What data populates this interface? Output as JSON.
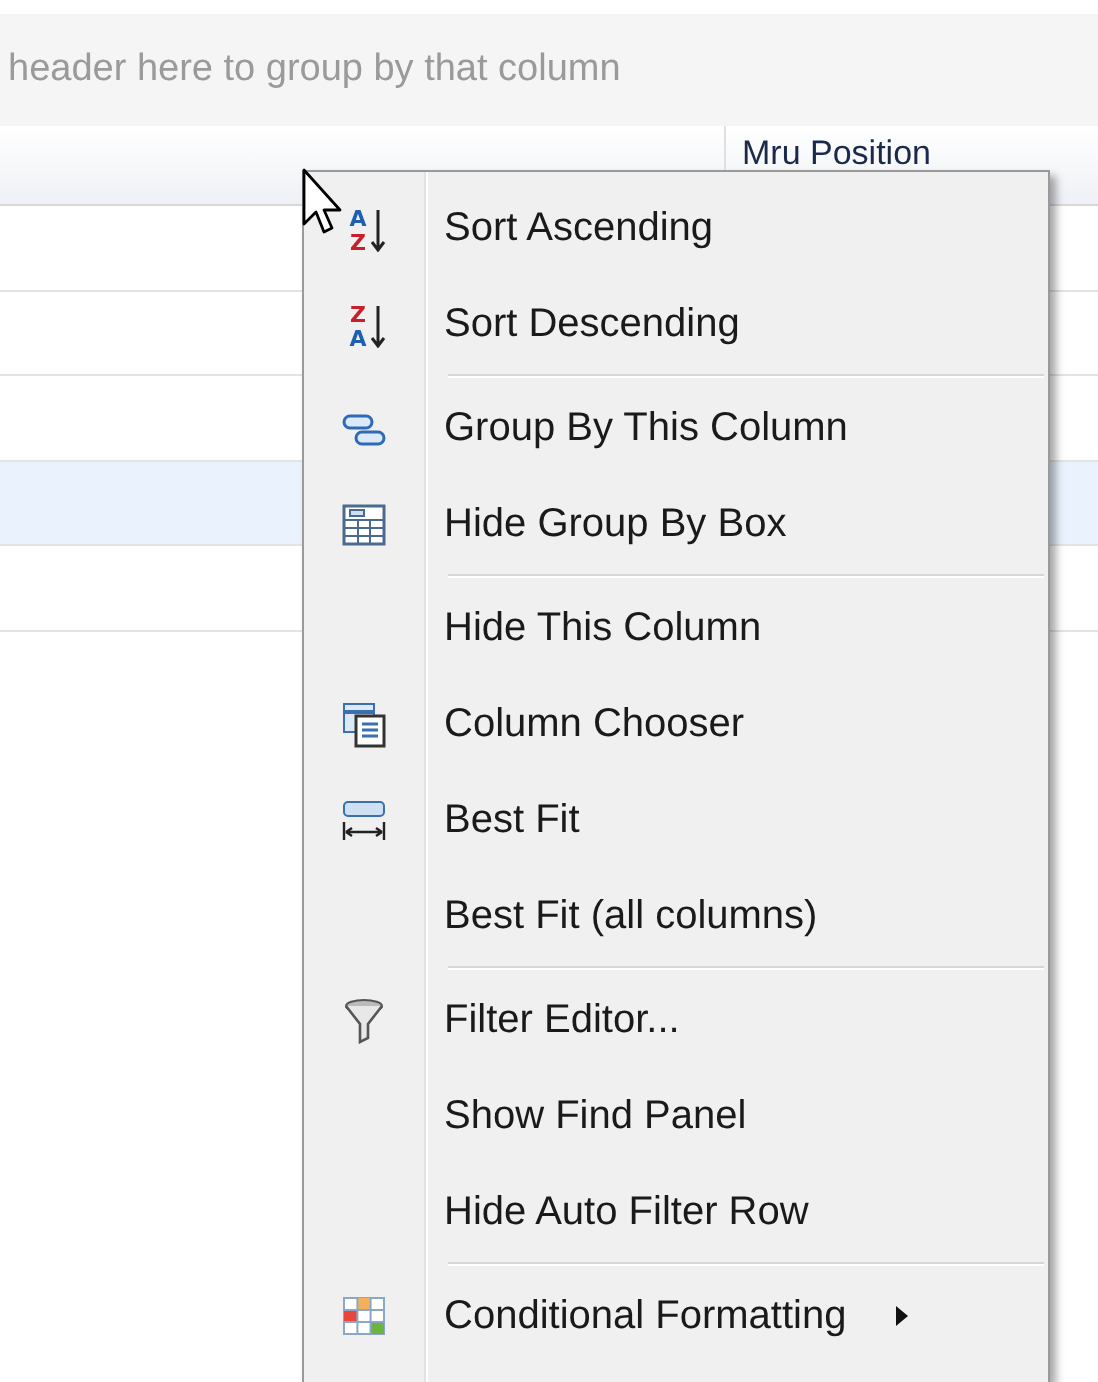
{
  "group_panel": {
    "hint": "header here to group by that column"
  },
  "grid": {
    "column_header": "Mru Position",
    "rows": [
      {
        "selected": false
      },
      {
        "selected": false
      },
      {
        "selected": false
      },
      {
        "selected": true
      },
      {
        "selected": false
      }
    ]
  },
  "context_menu": {
    "groups": [
      [
        {
          "label": "Sort Ascending",
          "submenu": false,
          "icon_letters": [
            "A",
            "Z"
          ]
        },
        {
          "label": "Sort Descending",
          "submenu": false,
          "icon_letters": [
            "Z",
            "A"
          ]
        }
      ],
      [
        {
          "label": "Group By This Column",
          "submenu": false
        },
        {
          "label": "Hide Group By Box",
          "submenu": false
        }
      ],
      [
        {
          "label": "Hide This Column",
          "submenu": false
        },
        {
          "label": "Column Chooser",
          "submenu": false
        },
        {
          "label": "Best Fit",
          "submenu": false
        },
        {
          "label": "Best Fit (all columns)",
          "submenu": false
        }
      ],
      [
        {
          "label": "Filter Editor...",
          "submenu": false
        },
        {
          "label": "Show Find Panel",
          "submenu": false
        },
        {
          "label": "Hide Auto Filter Row",
          "submenu": false
        }
      ],
      [
        {
          "label": "Conditional Formatting",
          "submenu": true
        }
      ]
    ]
  }
}
